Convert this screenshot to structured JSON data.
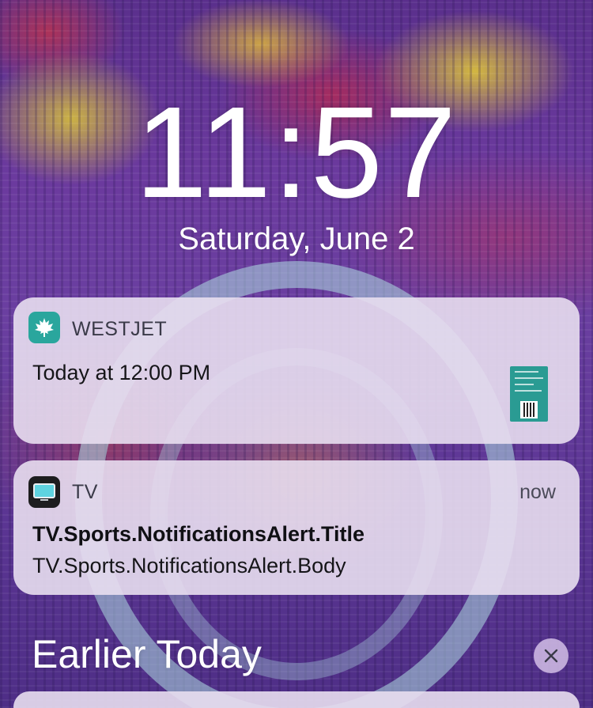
{
  "lock_screen": {
    "time": "11:57",
    "date": "Saturday, June 2"
  },
  "notifications": [
    {
      "app_name": "WESTJET",
      "icon": "maple-leaf-icon",
      "icon_color": "#2aa69d",
      "body": "Today at 12:00 PM",
      "attachment": "boarding-pass-thumbnail"
    },
    {
      "app_name": "TV",
      "icon": "tv-app-icon",
      "icon_color": "#1d1d1f",
      "timestamp": "now",
      "title": "TV.Sports.NotificationsAlert.Title",
      "body": "TV.Sports.NotificationsAlert.Body"
    }
  ],
  "earlier_section": {
    "title": "Earlier Today",
    "clear_icon": "close-icon"
  }
}
